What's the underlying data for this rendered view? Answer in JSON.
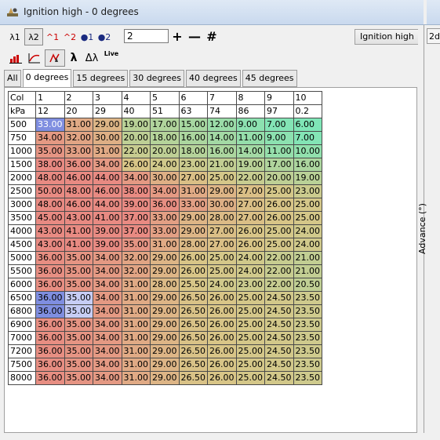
{
  "window": {
    "title": "Ignition high - 0 degrees"
  },
  "toolbar": {
    "row1": [
      {
        "label": "λ1",
        "icon": "lambda-1-icon"
      },
      {
        "label": "λ2",
        "icon": "lambda-2-icon",
        "selected": true
      },
      {
        "label": "^1",
        "icon": "caret-1-icon"
      },
      {
        "label": "^2",
        "icon": "caret-2-icon"
      },
      {
        "label": "●1",
        "icon": "drop-1-icon"
      },
      {
        "label": "●2",
        "icon": "drop-2-icon"
      }
    ],
    "step_value": "2",
    "plus_label": "+",
    "minus_label": "—",
    "hash_label": "#",
    "map_select": "Ignition high",
    "row2": [
      {
        "label": "",
        "icon": "bar-graph-icon"
      },
      {
        "label": "",
        "icon": "curve-graph-icon"
      },
      {
        "label": "",
        "icon": "hand-cursor-icon",
        "selected": true
      },
      {
        "label": "λ",
        "icon": "lambda-icon"
      },
      {
        "label": "Δλ",
        "icon": "delta-lambda-icon"
      },
      {
        "label": "Live",
        "icon": "live-icon"
      }
    ]
  },
  "tabs": [
    "All",
    "0 degrees",
    "15 degrees",
    "30 degrees",
    "40 degrees",
    "45 degrees"
  ],
  "active_tab": 1,
  "table": {
    "col_label": "Col",
    "kpa_label": "kPa",
    "col_numbers": [
      "1",
      "2",
      "3",
      "4",
      "5",
      "6",
      "7",
      "8",
      "9",
      "10"
    ],
    "kpa_values": [
      "12",
      "20",
      "29",
      "40",
      "51",
      "63",
      "74",
      "86",
      "97",
      "0.2"
    ],
    "rows": [
      {
        "rpm": "500",
        "v": [
          "33.00",
          "31.00",
          "29.00",
          "19.00",
          "17.00",
          "15.00",
          "12.00",
          "9.00",
          "7.00",
          "6.00"
        ]
      },
      {
        "rpm": "750",
        "v": [
          "34.00",
          "32.00",
          "30.00",
          "20.00",
          "18.00",
          "16.00",
          "14.00",
          "11.00",
          "9.00",
          "7.00"
        ]
      },
      {
        "rpm": "1000",
        "v": [
          "35.00",
          "33.00",
          "31.00",
          "22.00",
          "20.00",
          "18.00",
          "16.00",
          "14.00",
          "11.00",
          "10.00"
        ]
      },
      {
        "rpm": "1500",
        "v": [
          "38.00",
          "36.00",
          "34.00",
          "26.00",
          "24.00",
          "23.00",
          "21.00",
          "19.00",
          "17.00",
          "16.00"
        ]
      },
      {
        "rpm": "2000",
        "v": [
          "48.00",
          "46.00",
          "44.00",
          "34.00",
          "30.00",
          "27.00",
          "25.00",
          "22.00",
          "20.00",
          "19.00"
        ]
      },
      {
        "rpm": "2500",
        "v": [
          "50.00",
          "48.00",
          "46.00",
          "38.00",
          "34.00",
          "31.00",
          "29.00",
          "27.00",
          "25.00",
          "23.00"
        ]
      },
      {
        "rpm": "3000",
        "v": [
          "48.00",
          "46.00",
          "44.00",
          "39.00",
          "36.00",
          "33.00",
          "30.00",
          "27.00",
          "26.00",
          "25.00"
        ]
      },
      {
        "rpm": "3500",
        "v": [
          "45.00",
          "43.00",
          "41.00",
          "37.00",
          "33.00",
          "29.00",
          "28.00",
          "27.00",
          "26.00",
          "25.00"
        ]
      },
      {
        "rpm": "4000",
        "v": [
          "43.00",
          "41.00",
          "39.00",
          "37.00",
          "33.00",
          "29.00",
          "27.00",
          "26.00",
          "25.00",
          "24.00"
        ]
      },
      {
        "rpm": "4500",
        "v": [
          "43.00",
          "41.00",
          "39.00",
          "35.00",
          "31.00",
          "28.00",
          "27.00",
          "26.00",
          "25.00",
          "24.00"
        ]
      },
      {
        "rpm": "5000",
        "v": [
          "36.00",
          "35.00",
          "34.00",
          "32.00",
          "29.00",
          "26.00",
          "25.00",
          "24.00",
          "22.00",
          "21.00"
        ]
      },
      {
        "rpm": "5500",
        "v": [
          "36.00",
          "35.00",
          "34.00",
          "32.00",
          "29.00",
          "26.00",
          "25.00",
          "24.00",
          "22.00",
          "21.00"
        ]
      },
      {
        "rpm": "6000",
        "v": [
          "36.00",
          "35.00",
          "34.00",
          "31.00",
          "28.00",
          "25.50",
          "24.00",
          "23.00",
          "22.00",
          "20.50"
        ]
      },
      {
        "rpm": "6500",
        "v": [
          "36.00",
          "35.00",
          "34.00",
          "31.00",
          "29.00",
          "26.50",
          "26.00",
          "25.00",
          "24.50",
          "23.50"
        ]
      },
      {
        "rpm": "6800",
        "v": [
          "36.00",
          "35.00",
          "34.00",
          "31.00",
          "29.00",
          "26.50",
          "26.00",
          "25.00",
          "24.50",
          "23.50"
        ]
      },
      {
        "rpm": "6900",
        "v": [
          "36.00",
          "35.00",
          "34.00",
          "31.00",
          "29.00",
          "26.50",
          "26.00",
          "25.00",
          "24.50",
          "23.50"
        ]
      },
      {
        "rpm": "7000",
        "v": [
          "36.00",
          "35.00",
          "34.00",
          "31.00",
          "29.00",
          "26.50",
          "26.00",
          "25.00",
          "24.50",
          "23.50"
        ]
      },
      {
        "rpm": "7200",
        "v": [
          "36.00",
          "35.00",
          "34.00",
          "31.00",
          "29.00",
          "26.50",
          "26.00",
          "25.00",
          "24.50",
          "23.50"
        ]
      },
      {
        "rpm": "7500",
        "v": [
          "36.00",
          "35.00",
          "34.00",
          "31.00",
          "29.00",
          "26.50",
          "26.00",
          "25.00",
          "24.50",
          "23.50"
        ]
      },
      {
        "rpm": "8000",
        "v": [
          "36.00",
          "35.00",
          "34.00",
          "31.00",
          "29.00",
          "26.50",
          "26.00",
          "25.00",
          "24.50",
          "23.50"
        ]
      }
    ]
  },
  "right_panel": {
    "button_label": "2d",
    "axis_label": "Advance (°)"
  },
  "colors": {
    "high": "#e88a82",
    "mid": "#d8c687",
    "low": "#7fe6b7",
    "selected_strong": "#7f8ee0",
    "selected_light": "#c7cdf5"
  }
}
